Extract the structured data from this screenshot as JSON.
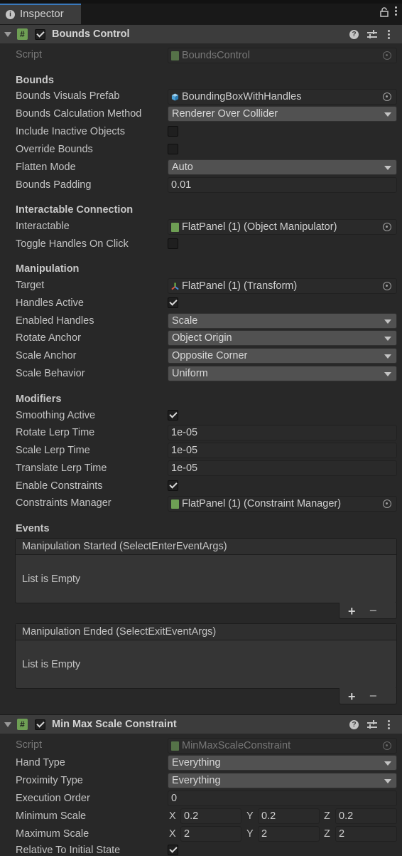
{
  "tab": {
    "label": "Inspector"
  },
  "bounds_control": {
    "title": "Bounds Control",
    "script_label": "Script",
    "script_value": "BoundsControl",
    "sections": {
      "bounds": "Bounds",
      "interactable": "Interactable Connection",
      "manipulation": "Manipulation",
      "modifiers": "Modifiers",
      "events": "Events"
    },
    "fields": {
      "visuals_prefab": {
        "label": "Bounds Visuals Prefab",
        "value": "BoundingBoxWithHandles"
      },
      "calc_method": {
        "label": "Bounds Calculation Method",
        "value": "Renderer Over Collider"
      },
      "include_inactive": {
        "label": "Include Inactive Objects"
      },
      "override_bounds": {
        "label": "Override Bounds"
      },
      "flatten_mode": {
        "label": "Flatten Mode",
        "value": "Auto"
      },
      "bounds_padding": {
        "label": "Bounds Padding",
        "value": "0.01"
      },
      "interactable": {
        "label": "Interactable",
        "value": "FlatPanel (1) (Object Manipulator)"
      },
      "toggle_handles": {
        "label": "Toggle Handles On Click"
      },
      "target": {
        "label": "Target",
        "value": "FlatPanel (1) (Transform)"
      },
      "handles_active": {
        "label": "Handles Active"
      },
      "enabled_handles": {
        "label": "Enabled Handles",
        "value": "Scale"
      },
      "rotate_anchor": {
        "label": "Rotate Anchor",
        "value": "Object Origin"
      },
      "scale_anchor": {
        "label": "Scale Anchor",
        "value": "Opposite Corner"
      },
      "scale_behavior": {
        "label": "Scale Behavior",
        "value": "Uniform"
      },
      "smoothing_active": {
        "label": "Smoothing Active"
      },
      "rotate_lerp": {
        "label": "Rotate Lerp Time",
        "value": "1e-05"
      },
      "scale_lerp": {
        "label": "Scale Lerp Time",
        "value": "1e-05"
      },
      "translate_lerp": {
        "label": "Translate Lerp Time",
        "value": "1e-05"
      },
      "enable_constraints": {
        "label": "Enable Constraints"
      },
      "constraints_manager": {
        "label": "Constraints Manager",
        "value": "FlatPanel (1) (Constraint Manager)"
      }
    },
    "events": {
      "started": {
        "label": "Manipulation Started (SelectEnterEventArgs)",
        "empty": "List is Empty"
      },
      "ended": {
        "label": "Manipulation Ended (SelectExitEventArgs)",
        "empty": "List is Empty"
      },
      "plus": "+",
      "minus": "−"
    }
  },
  "min_max": {
    "title": "Min Max Scale Constraint",
    "script_label": "Script",
    "script_value": "MinMaxScaleConstraint",
    "fields": {
      "hand_type": {
        "label": "Hand Type",
        "value": "Everything"
      },
      "proximity_type": {
        "label": "Proximity Type",
        "value": "Everything"
      },
      "execution_order": {
        "label": "Execution Order",
        "value": "0"
      },
      "minimum_scale": {
        "label": "Minimum Scale",
        "x": "0.2",
        "y": "0.2",
        "z": "0.2"
      },
      "maximum_scale": {
        "label": "Maximum Scale",
        "x": "2",
        "y": "2",
        "z": "2"
      },
      "relative_initial": {
        "label": "Relative To Initial State"
      }
    },
    "axis": {
      "x": "X",
      "y": "Y",
      "z": "Z"
    }
  },
  "colors": {
    "accent": "#3a79bb",
    "script_green": "#6e9f54"
  }
}
